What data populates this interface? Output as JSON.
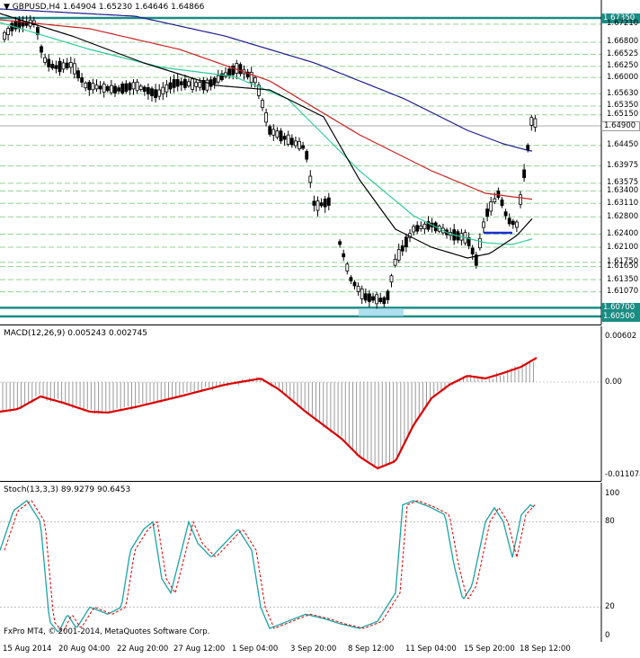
{
  "main_pane": {
    "symbol_label": "GBPUSD,H4",
    "ohlc": "1.64904 1.65230 1.64646 1.64866",
    "price_ticks": [
      "1.67350",
      "1.67210",
      "1.66800",
      "1.66525",
      "1.66250",
      "1.66000",
      "1.65630",
      "1.65350",
      "1.65150",
      "1.64900",
      "1.64450",
      "1.63975",
      "1.63575",
      "1.63400",
      "1.63110",
      "1.62800",
      "1.62400",
      "1.62100",
      "1.61750",
      "1.61650",
      "1.61350",
      "1.61070",
      "1.60700",
      "1.60500"
    ],
    "highlighted_ticks": [
      "1.67350",
      "1.60700",
      "1.60500"
    ],
    "current_price": "1.64900"
  },
  "macd_pane": {
    "label": "MACD(12,26,9) 0.005243 0.002745",
    "ticks": [
      "0.00602",
      "0.00",
      "-0.011074"
    ]
  },
  "stoch_pane": {
    "label": "Stoch(13,3,3) 89.9279 90.6453",
    "ticks": [
      "100",
      "80",
      "20",
      "0"
    ]
  },
  "x_axis": {
    "dates": [
      "15 Aug 2014",
      "20 Aug 04:00",
      "22 Aug 20:00",
      "27 Aug 12:00",
      "1 Sep 04:00",
      "3 Sep 20:00",
      "8 Sep 12:00",
      "11 Sep 04:00",
      "15 Sep 20:00",
      "18 Sep 12:00"
    ]
  },
  "copyright": "FxPro MT4, © 2001-2014, MetaQuotes Software Corp.",
  "colors": {
    "candle": "#000000",
    "ma_fast": "#000000",
    "ma_green": "#2ecc9a",
    "ma_red": "#cc2222",
    "ma_blue": "#1a1a8c",
    "level_line": "#8fd48f",
    "highlight": "#1a8c83",
    "macd_signal": "#dd0000",
    "macd_hist": "#999999",
    "stoch_main": "#1aa3a3",
    "stoch_signal": "#dd0000"
  }
}
